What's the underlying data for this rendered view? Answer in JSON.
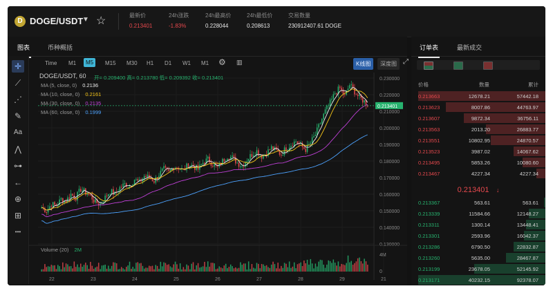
{
  "header": {
    "coin_glyph": "D",
    "pair": "DOGE/USDT",
    "stats": [
      {
        "label": "最新价",
        "value": "0.213401",
        "color": "#e5484d"
      },
      {
        "label": "24h涨跌",
        "value": "-1.83%",
        "color": "#e5484d"
      },
      {
        "label": "24h最高价",
        "value": "0.228044",
        "color": "#e6e6e6"
      },
      {
        "label": "24h最低价",
        "value": "0.208613",
        "color": "#e6e6e6"
      },
      {
        "label": "交易数量",
        "value": "230912407.61 DOGE",
        "color": "#e6e6e6"
      }
    ]
  },
  "left_tabs": {
    "chart": "图表",
    "overview": "币种概括"
  },
  "intervals": [
    "Time",
    "M1",
    "M5",
    "M15",
    "M30",
    "H1",
    "D1",
    "W1",
    "M1"
  ],
  "selected_interval": "M5",
  "view_buttons": {
    "kline": "K线图",
    "depth": "深度图"
  },
  "legend": {
    "title": "DOGE/USDT, 60",
    "ohlc": "开= 0.209400  高= 0.213780  低= 0.209392  收= 0.213401",
    "ma": [
      {
        "label": "MA (5, close, 0)",
        "value": "0.2136",
        "color": "#f0f0f0"
      },
      {
        "label": "MA (10, close, 0)",
        "value": "0.2161",
        "color": "#f5c518"
      },
      {
        "label": "MA (30, close, 0)",
        "value": "0.2135",
        "color": "#c040d8"
      },
      {
        "label": "MA (60, close, 0)",
        "value": "0.1999",
        "color": "#4da3ff"
      }
    ],
    "volume": "Volume (20)",
    "volume_val": "2M"
  },
  "icons": {
    "tools": [
      "crosshair-icon",
      "line-icon",
      "fib-icon",
      "brush-icon",
      "text-icon",
      "pattern-icon",
      "measure-icon",
      "back-arrow-icon",
      "zoom-icon",
      "lock-icon",
      "more-icon"
    ],
    "tool_glyphs": [
      "✛",
      "⟋",
      "⋰",
      "✎",
      "Aa",
      "⋀",
      "⊶",
      "←",
      "⊕",
      "⊞",
      "•••"
    ]
  },
  "chart_data": {
    "type": "candlestick",
    "price_axis": [
      "0.230000",
      "0.220000",
      "0.210000",
      "0.200000",
      "0.190000",
      "0.180000",
      "0.170000",
      "0.160000",
      "0.150000",
      "0.140000",
      "0.130000"
    ],
    "ylim": [
      0.13,
      0.23
    ],
    "current_price": "0.213401",
    "x_ticks": [
      "22",
      "23",
      "24",
      "25",
      "26",
      "27",
      "28",
      "29",
      "21"
    ],
    "volume_axis": [
      "4M",
      "0"
    ],
    "trend": {
      "closes": [
        0.152,
        0.15,
        0.154,
        0.153,
        0.157,
        0.156,
        0.16,
        0.158,
        0.163,
        0.161,
        0.159,
        0.155,
        0.154,
        0.158,
        0.162,
        0.16,
        0.164,
        0.166,
        0.165,
        0.169,
        0.167,
        0.171,
        0.17,
        0.168,
        0.172,
        0.175,
        0.173,
        0.177,
        0.176,
        0.174,
        0.178,
        0.177,
        0.175,
        0.179,
        0.181,
        0.178,
        0.176,
        0.18,
        0.183,
        0.182,
        0.179,
        0.177,
        0.181,
        0.184,
        0.186,
        0.183,
        0.185,
        0.188,
        0.186,
        0.184,
        0.188,
        0.19,
        0.192,
        0.189,
        0.187,
        0.191,
        0.196,
        0.203,
        0.21,
        0.215,
        0.221,
        0.224,
        0.219,
        0.226,
        0.222,
        0.218,
        0.216,
        0.213
      ]
    }
  },
  "right_tabs": {
    "book": "订单表",
    "trades": "最新成交"
  },
  "orderbook": {
    "headers": {
      "price": "价格",
      "qty": "数量",
      "total": "累计"
    },
    "asks": [
      {
        "price": "0.213663",
        "qty": "12678.21",
        "total": "57442.18",
        "depth": 1.0
      },
      {
        "price": "0.213623",
        "qty": "8007.86",
        "total": "44763.97",
        "depth": 0.78
      },
      {
        "price": "0.213607",
        "qty": "9872.34",
        "total": "36756.11",
        "depth": 0.64
      },
      {
        "price": "0.213563",
        "qty": "2013.20",
        "total": "26883.77",
        "depth": 0.47
      },
      {
        "price": "0.213551",
        "qty": "10802.95",
        "total": "24870.57",
        "depth": 0.43
      },
      {
        "price": "0.213523",
        "qty": "3987.02",
        "total": "14067.62",
        "depth": 0.25
      },
      {
        "price": "0.213495",
        "qty": "5853.26",
        "total": "10080.60",
        "depth": 0.18
      },
      {
        "price": "0.213467",
        "qty": "4227.34",
        "total": "4227.34",
        "depth": 0.07
      }
    ],
    "last_price": "0.213401",
    "last_arrow": "↓",
    "bids": [
      {
        "price": "0.213367",
        "qty": "563.61",
        "total": "563.61",
        "depth": 0.01
      },
      {
        "price": "0.213339",
        "qty": "11584.66",
        "total": "12148.27",
        "depth": 0.13
      },
      {
        "price": "0.213311",
        "qty": "1300.14",
        "total": "13448.41",
        "depth": 0.15
      },
      {
        "price": "0.213301",
        "qty": "2593.96",
        "total": "16042.37",
        "depth": 0.17
      },
      {
        "price": "0.213286",
        "qty": "6790.50",
        "total": "22832.87",
        "depth": 0.25
      },
      {
        "price": "0.213260",
        "qty": "5635.00",
        "total": "28467.87",
        "depth": 0.31
      },
      {
        "price": "0.213199",
        "qty": "23678.05",
        "total": "52145.92",
        "depth": 0.56
      },
      {
        "price": "0.213171",
        "qty": "40232.15",
        "total": "92378.07",
        "depth": 1.0
      }
    ]
  }
}
